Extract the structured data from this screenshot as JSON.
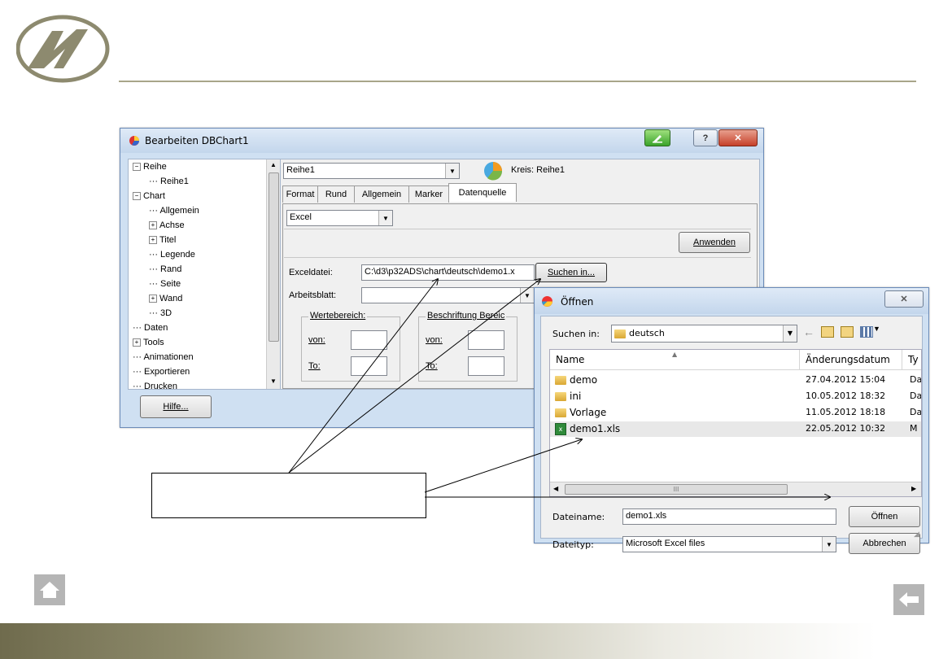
{
  "dbchart_dialog": {
    "title": "Bearbeiten DBChart1",
    "tree": [
      {
        "label": "Reihe",
        "expander": "minus"
      },
      {
        "label": "Reihe1",
        "expander": ""
      },
      {
        "label": "Chart",
        "expander": "minus"
      },
      {
        "label": "Allgemein",
        "expander": ""
      },
      {
        "label": "Achse",
        "expander": "plus"
      },
      {
        "label": "Titel",
        "expander": "plus"
      },
      {
        "label": "Legende",
        "expander": ""
      },
      {
        "label": "Rand",
        "expander": ""
      },
      {
        "label": "Seite",
        "expander": ""
      },
      {
        "label": "Wand",
        "expander": "plus"
      },
      {
        "label": "3D",
        "expander": ""
      },
      {
        "label": "Daten",
        "expander": ""
      },
      {
        "label": "Tools",
        "expander": "plus"
      },
      {
        "label": "Animationen",
        "expander": ""
      },
      {
        "label": "Exportieren",
        "expander": ""
      },
      {
        "label": "Drucken",
        "expander": ""
      }
    ],
    "series_select": "Reihe1",
    "series_info": "Kreis: Reihe1",
    "tabs": [
      "Format",
      "Rund",
      "Allgemein",
      "Marker",
      "Datenquelle"
    ],
    "active_tab": "Datenquelle",
    "source_select": "Excel",
    "apply_button": "Anwenden",
    "excel_file_label": "Exceldatei:",
    "excel_file_value": "C:\\d3\\p32ADS\\chart\\deutsch\\demo1.x",
    "browse_button": "Suchen in...",
    "worksheet_label": "Arbeitsblatt:",
    "worksheet_value": "",
    "value_range_group": "Wertebereich:",
    "label_range_group": "Beschriftung Bereic",
    "from_label": "von:",
    "to_label": "To:",
    "help_button": "Hilfe..."
  },
  "open_dialog": {
    "title": "Öffnen",
    "look_in_label": "Suchen in:",
    "look_in_value": "deutsch",
    "columns": [
      "Name",
      "Änderungsdatum",
      "Ty"
    ],
    "files": [
      {
        "name": "demo",
        "date": "27.04.2012 15:04",
        "type": "Da",
        "kind": "folder"
      },
      {
        "name": "ini",
        "date": "10.05.2012 18:32",
        "type": "Da",
        "kind": "folder"
      },
      {
        "name": "Vorlage",
        "date": "11.05.2012 18:18",
        "type": "Da",
        "kind": "folder"
      },
      {
        "name": "demo1.xls",
        "date": "22.05.2012 10:32",
        "type": "M",
        "kind": "xls"
      }
    ],
    "scroll_thumb_text": "III",
    "filename_label": "Dateiname:",
    "filename_value": "demo1.xls",
    "filetype_label": "Dateityp:",
    "filetype_value": "Microsoft Excel files",
    "open_button": "Öffnen",
    "cancel_button": "Abbrechen"
  },
  "callout_text": ""
}
